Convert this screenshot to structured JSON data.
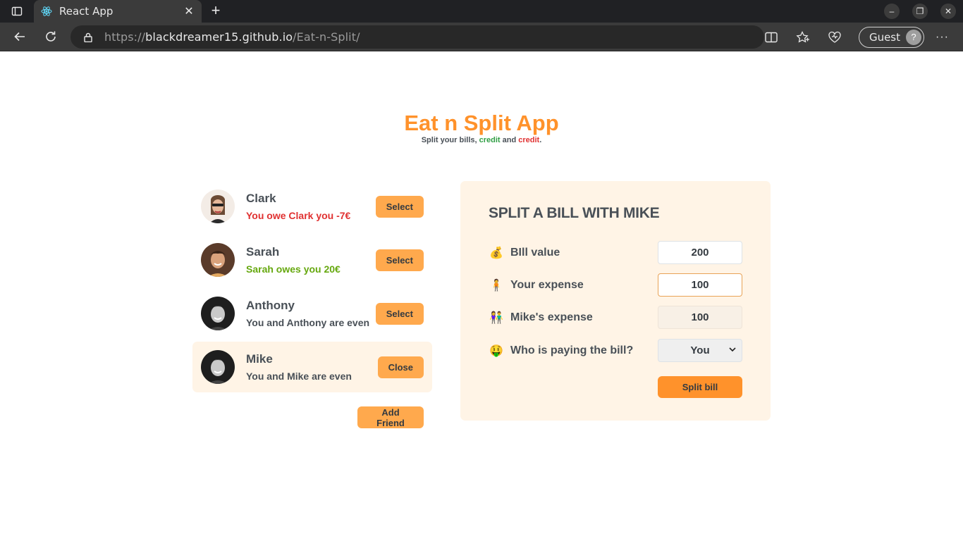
{
  "browser": {
    "tab_title": "React App",
    "url_prefix": "https://",
    "url_host": "blackdreamer15.github.io",
    "url_path": "/Eat-n-Split/",
    "guest_label": "Guest"
  },
  "app": {
    "title": "Eat n Split App",
    "subtitle_start": "Split your bills, ",
    "subtitle_green": "credit",
    "subtitle_mid": " and ",
    "subtitle_red": "credit",
    "subtitle_end": "."
  },
  "friends": [
    {
      "name": "Clark",
      "status": "You owe Clark you -7€",
      "button": "Select"
    },
    {
      "name": "Sarah",
      "status": "Sarah owes you 20€",
      "button": "Select"
    },
    {
      "name": "Anthony",
      "status": "You and Anthony are even",
      "button": "Select"
    },
    {
      "name": "Mike",
      "status": "You and Mike are even",
      "button": "Close"
    }
  ],
  "add_friend_label": "Add Friend",
  "split": {
    "title": "SPLIT A BILL WITH MIKE",
    "bill_label": "BIll value",
    "bill_value": "200",
    "expense_label": "Your expense",
    "expense_value": "100",
    "friend_expense_label": "Mike's expense",
    "friend_expense_value": "100",
    "payer_label": "Who is paying the bill?",
    "payer_value": "You",
    "submit_label": "Split bill"
  },
  "colors": {
    "accent": "#ff922b",
    "button": "#ffa94d",
    "panel_bg": "#fff4e6",
    "positive": "#66a80f",
    "negative": "#e03131"
  }
}
